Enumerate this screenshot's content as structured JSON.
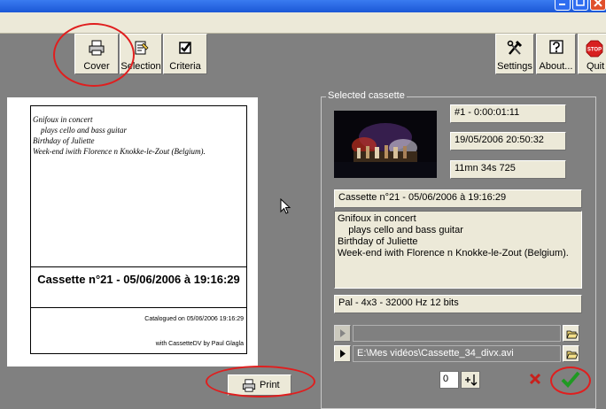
{
  "toolbar": {
    "cover_label": "Cover",
    "selection_label": "Selection",
    "criteria_label": "Criteria",
    "settings_label": "Settings",
    "about_label": "About...",
    "quit_label": "Quit",
    "stop_text": "STOP"
  },
  "preview": {
    "lines": [
      "Gnifoux in concert",
      "    plays cello and bass guitar",
      "Birthday of Juliette",
      "Week-end iwith Florence n Knokke-le-Zout (Belgium)."
    ],
    "title": "Cassette n°21 - 05/06/2006 à 19:16:29",
    "catalogued": "Catalogued on 05/06/2006 19:16:29",
    "with_text": "with CassetteDV by Paul Glagla"
  },
  "print_label": "Print",
  "cassette": {
    "group_label": "Selected cassette",
    "clip_index": "#1 - 0:00:01:11",
    "datetime": "19/05/2006 20:50:32",
    "duration": "11mn 34s 725",
    "title": "Cassette n°21 - 05/06/2006 à 19:16:29",
    "description": [
      "Gnifoux in concert",
      "    plays cello and bass guitar",
      "Birthday of Juliette",
      "Week-end iwith Florence n Knokke-le-Zout (Belgium)."
    ],
    "format": "Pal - 4x3 - 32000 Hz 12 bits",
    "path1": "",
    "path2": "E:\\Mes vidéos\\Cassette_34_divx.avi",
    "number": "0"
  },
  "colors": {
    "background": "#808080",
    "button_face": "#ece9d8",
    "annotation_red": "#e01e1e",
    "ok_green": "#1f9a22",
    "cancel_red": "#c8201c"
  }
}
